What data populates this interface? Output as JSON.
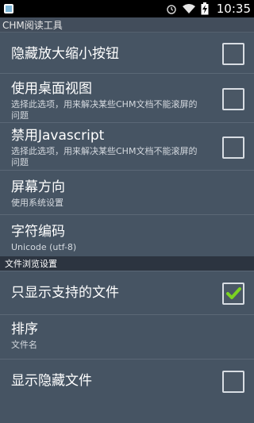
{
  "statusbar": {
    "time": "10:35",
    "icons": [
      "app-icon",
      "alarm-icon",
      "wifi-icon",
      "battery-charging-icon"
    ]
  },
  "app": {
    "title": "CHM阅读工具"
  },
  "prefs": [
    {
      "title": "隐藏放大缩小按钮",
      "summary": "",
      "checked": false
    },
    {
      "title": "使用桌面视图",
      "summary": "选择此选项，用来解决某些CHM文档不能滚屏的问题",
      "checked": false
    },
    {
      "title": "禁用Javascript",
      "summary": "选择此选项，用来解决某些CHM文档不能滚屏的问题",
      "checked": false
    },
    {
      "title": "屏幕方向",
      "summary": "使用系统设置"
    },
    {
      "title": "字符编码",
      "summary": "Unicode (utf-8)"
    }
  ],
  "file_category": {
    "label": "文件浏览设置"
  },
  "file_prefs": [
    {
      "title": "只显示支持的文件",
      "summary": "",
      "checked": true
    },
    {
      "title": "排序",
      "summary": "文件名"
    },
    {
      "title": "显示隐藏文件",
      "summary": "",
      "checked": false
    }
  ],
  "colors": {
    "check": "#7bd321",
    "background": "#465463",
    "category": "#2c3440"
  }
}
